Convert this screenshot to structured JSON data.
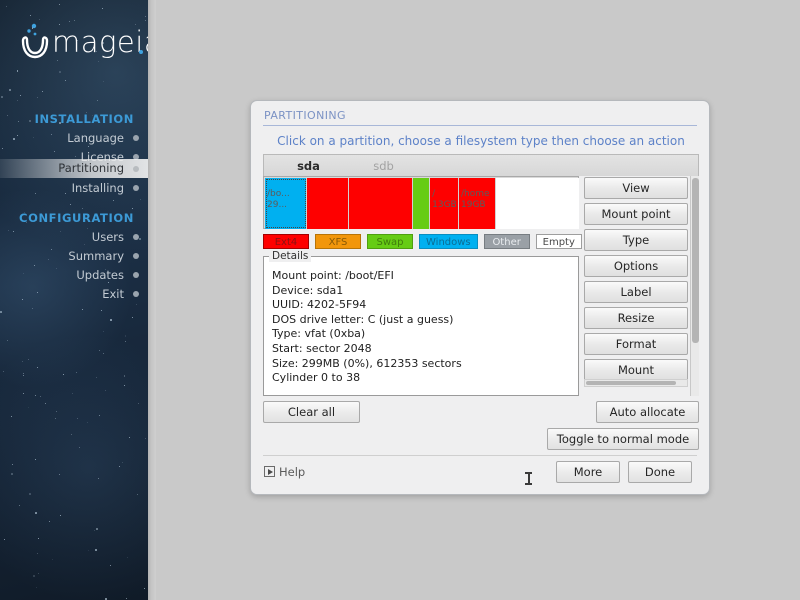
{
  "sidebar": {
    "logo_text": "mageia",
    "sections": [
      {
        "heading": "INSTALLATION",
        "items": [
          {
            "label": "Language",
            "active": false
          },
          {
            "label": "License",
            "active": false
          },
          {
            "label": "Partitioning",
            "active": true
          },
          {
            "label": "Installing",
            "active": false
          }
        ]
      },
      {
        "heading": "CONFIGURATION",
        "items": [
          {
            "label": "Users",
            "active": false
          },
          {
            "label": "Summary",
            "active": false
          },
          {
            "label": "Updates",
            "active": false
          },
          {
            "label": "Exit",
            "active": false
          }
        ]
      }
    ]
  },
  "dialog": {
    "title": "PARTITIONING",
    "subtitle": "Click on a partition, choose a filesystem type then choose an action",
    "tabs": [
      {
        "label": "sda",
        "active": true
      },
      {
        "label": "sdb",
        "active": false
      }
    ],
    "partitions": [
      {
        "mount": "/bo...",
        "size": "29...",
        "color": "#00b0f0",
        "width_pct": 13.4,
        "selected": true
      },
      {
        "mount": "",
        "size": "",
        "color": "#fe0000",
        "width_pct": 13.4,
        "selected": false
      },
      {
        "mount": "",
        "size": "",
        "color": "#fe0000",
        "width_pct": 20.4,
        "selected": false
      },
      {
        "mount": "",
        "size": "",
        "color": "#66cc14",
        "width_pct": 5.4,
        "selected": false
      },
      {
        "mount": "/",
        "size": "13GB",
        "color": "#fe0000",
        "width_pct": 9.2,
        "selected": false
      },
      {
        "mount": "/home",
        "size": "19GB",
        "color": "#fe0000",
        "width_pct": 11.8,
        "selected": false
      },
      {
        "mount": "",
        "size": "",
        "color": "#ffffff",
        "width_pct": 26.4,
        "selected": false
      }
    ],
    "legend": [
      {
        "label": "Ext4",
        "bg": "#fe0000",
        "fg": "#8a1212",
        "border": "#a40000"
      },
      {
        "label": "XFS",
        "bg": "#f2960b",
        "fg": "#8a5a05",
        "border": "#b87408"
      },
      {
        "label": "Swap",
        "bg": "#66cc14",
        "fg": "#3f7c0c",
        "border": "#4f9f10"
      },
      {
        "label": "Windows",
        "bg": "#00b0f0",
        "fg": "#0b6d94",
        "border": "#0a8ec0"
      },
      {
        "label": "Other",
        "bg": "#9aa0a6",
        "fg": "#e9ecef",
        "border": "#777d82"
      },
      {
        "label": "Empty",
        "bg": "#ffffff",
        "fg": "#4a4a4a",
        "border": "#9e9e9e"
      }
    ],
    "details": {
      "legend_label": "Details",
      "lines": [
        "Mount point: /boot/EFI",
        "Device: sda1",
        "UUID: 4202-5F94",
        "DOS drive letter: C (just a guess)",
        "Type: vfat (0xba)",
        "Start: sector 2048",
        "Size: 299MB (0%), 612353 sectors",
        "Cylinder 0 to 38"
      ]
    },
    "side_buttons": [
      "View",
      "Mount point",
      "Type",
      "Options",
      "Label",
      "Resize",
      "Format",
      "Mount"
    ],
    "actions": {
      "clear_all": "Clear all",
      "auto_allocate": "Auto allocate",
      "toggle_mode": "Toggle to normal mode"
    },
    "footer": {
      "help": "Help",
      "more": "More",
      "done": "Done"
    }
  }
}
